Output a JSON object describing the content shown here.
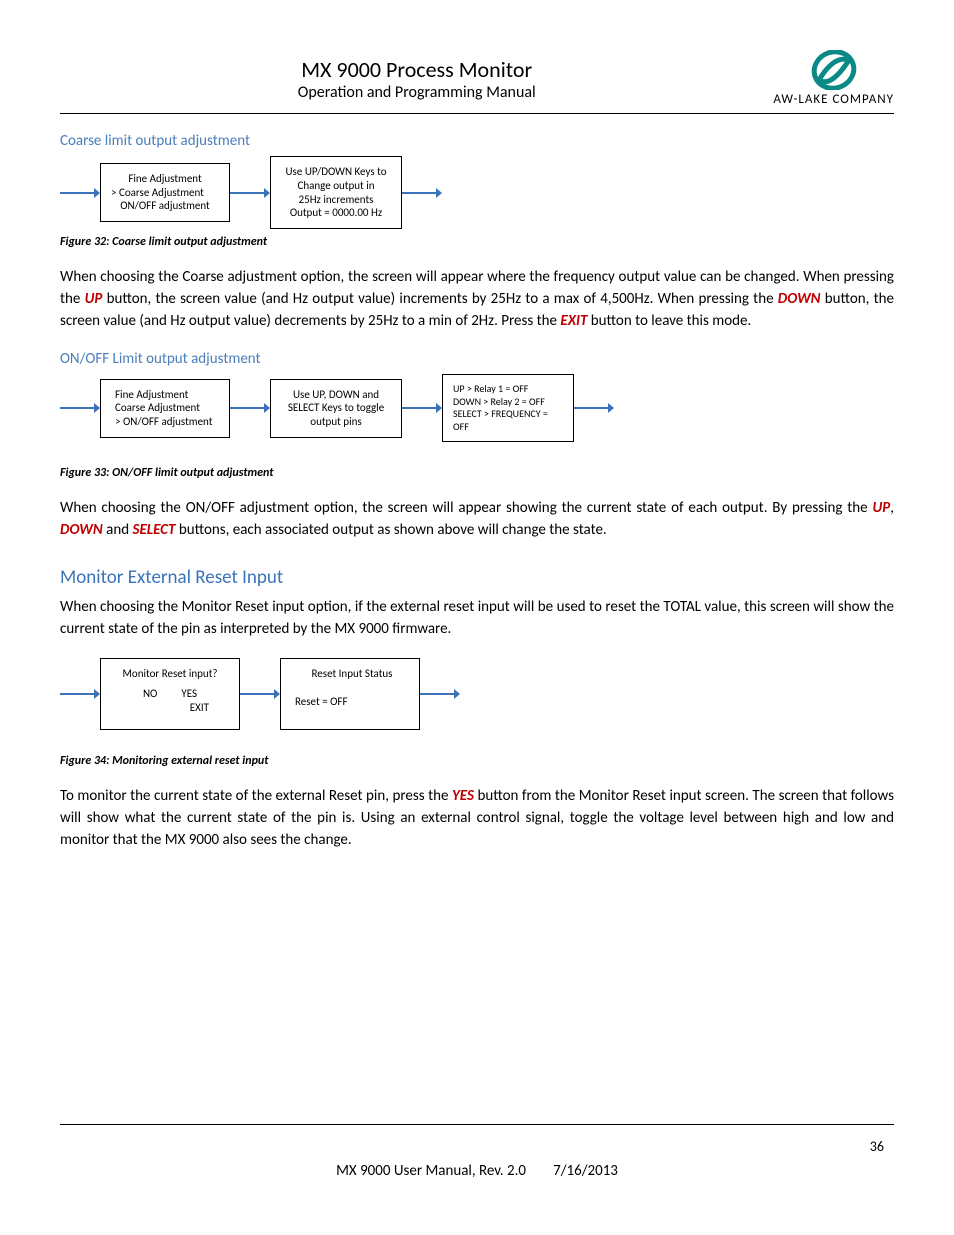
{
  "header": {
    "title": "MX 9000 Process Monitor",
    "subtitle": "Operation and Programming Manual",
    "company": "AW-LAKE COMPANY"
  },
  "sec_coarse": {
    "heading": "Coarse limit output adjustment",
    "fig_caption": "Figure 32:  Coarse limit output adjustment",
    "box1_l1": "Fine Adjustment",
    "box1_l2": ">  Coarse Adjustment",
    "box1_l3": "ON/OFF adjustment",
    "box2_l1": "Use UP/DOWN Keys to",
    "box2_l2": "Change output in",
    "box2_l3": "25Hz increments",
    "box2_l4": "Output = 0000.00 Hz"
  },
  "para1": {
    "t1": "When choosing the Coarse adjustment option, the screen will appear where the frequency output value can be changed.  When pressing the ",
    "up": "UP",
    "t2": " button, the screen value (and Hz output value) increments by 25Hz to a max of 4,500Hz.  When pressing the ",
    "down": "DOWN",
    "t3": " button, the screen value (and Hz output value) decrements by 25Hz to a min of 2Hz.  Press the ",
    "exit": "EXIT",
    "t4": " button to leave this mode."
  },
  "sec_onoff": {
    "heading": "ON/OFF Limit output adjustment",
    "fig_caption": "Figure 33:  ON/OFF limit output adjustment",
    "box1_l1": "Fine Adjustment",
    "box1_l2": "Coarse Adjustment",
    "box1_l3": ">  ON/OFF adjustment",
    "box2_l1": "Use UP, DOWN and",
    "box2_l2": "SELECT Keys to toggle",
    "box2_l3": "output pins",
    "box3_l1": "UP > Relay 1 = OFF",
    "box3_l2": "DOWN > Relay 2 = OFF",
    "box3_l3": "SELECT > FREQUENCY =",
    "box3_l4": "OFF"
  },
  "para2": {
    "t1": "When choosing the ON/OFF adjustment option, the screen will appear showing the current state of each output.  By pressing the ",
    "up": "UP",
    "comma1": ", ",
    "down": "DOWN",
    "and": " and ",
    "select": "SELECT",
    "t2": " buttons, each associated output as shown above will change the state."
  },
  "sec_monitor": {
    "heading": "Monitor External Reset Input",
    "para": "When choosing the Monitor Reset input option, if the external reset input will be used to reset the TOTAL value, this screen will show the current state of the pin as interpreted by the MX 9000 firmware.",
    "box1_l1": "Monitor Reset input?",
    "box1_no": "NO",
    "box1_yes": "YES",
    "box1_exit": "EXIT",
    "box2_l1": "Reset Input Status",
    "box2_l2": "Reset  = OFF",
    "fig_caption": "Figure 34:  Monitoring external reset input"
  },
  "para3": {
    "t1": "To monitor the current state of the external Reset pin, press the ",
    "yes": "YES",
    "t2": " button from the Monitor Reset input screen.  The screen that follows will show what the current state of the pin is.  Using an external control signal, toggle the voltage level between high and low and monitor that the MX 9000 also sees the change."
  },
  "footer": {
    "page": "36",
    "left": "MX 9000 User Manual, Rev. 2.0",
    "right": "7/16/2013"
  }
}
